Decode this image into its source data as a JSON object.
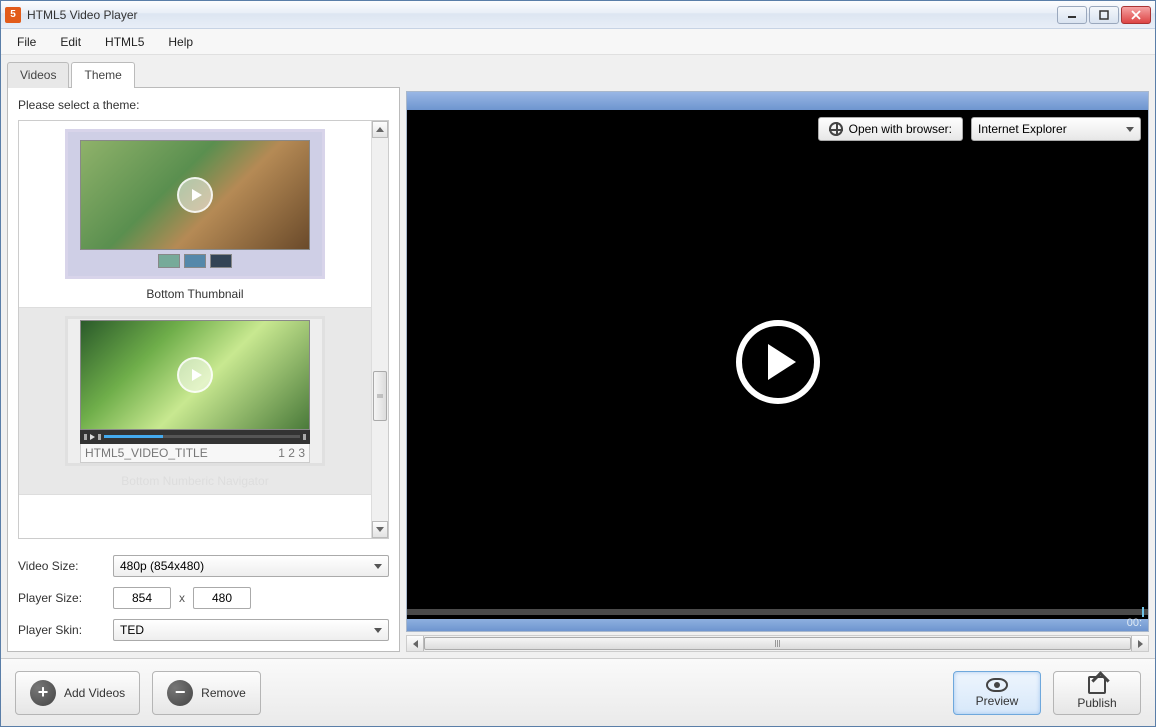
{
  "window": {
    "title": "HTML5 Video Player",
    "app_icon_text": "5"
  },
  "menu": {
    "file": "File",
    "edit": "Edit",
    "html5": "HTML5",
    "help": "Help"
  },
  "toolbar": {
    "open_browser": "Open with browser:",
    "browser_selected": "Internet Explorer"
  },
  "tabs": {
    "videos": "Videos",
    "theme": "Theme",
    "active": "theme"
  },
  "theme_panel": {
    "heading": "Please select a theme:",
    "items": [
      {
        "caption": "Bottom Thumbnail",
        "mini_title": ""
      },
      {
        "caption": "Bottom Numberic Navigator",
        "mini_title": "HTML5_VIDEO_TITLE",
        "mini_pages": "1 2 3"
      }
    ]
  },
  "settings": {
    "video_size_label": "Video Size:",
    "video_size_value": "480p (854x480)",
    "player_size_label": "Player Size:",
    "player_width": "854",
    "player_size_x": "x",
    "player_height": "480",
    "player_skin_label": "Player Skin:",
    "player_skin_value": "TED"
  },
  "player": {
    "time": "00:"
  },
  "bottom": {
    "add_videos": "Add Videos",
    "remove": "Remove",
    "preview": "Preview",
    "publish": "Publish"
  }
}
